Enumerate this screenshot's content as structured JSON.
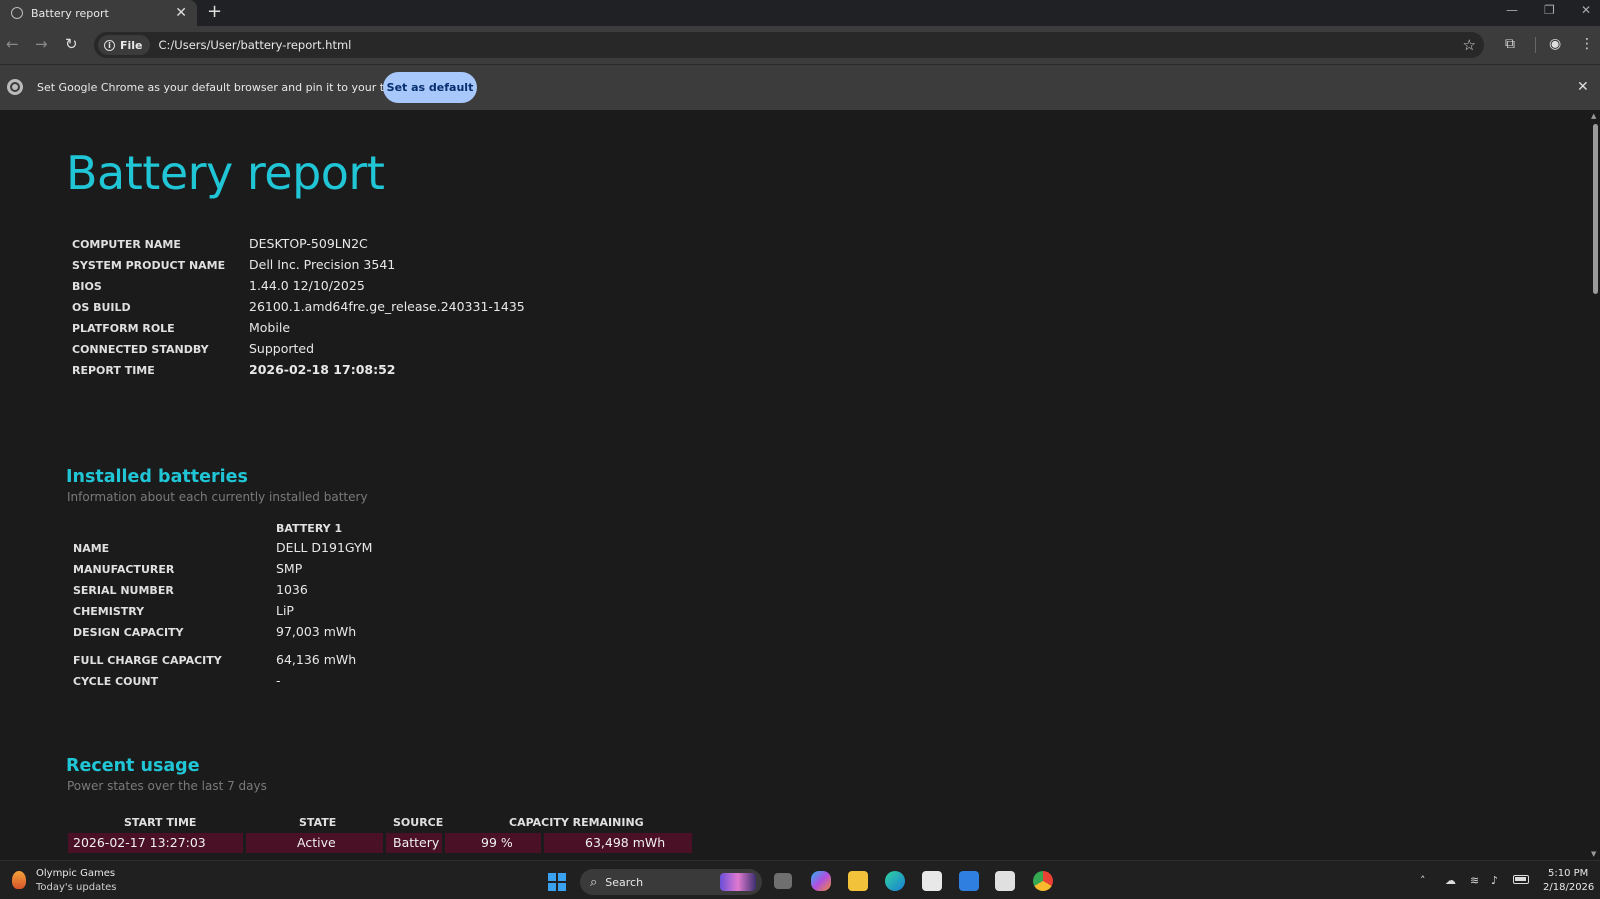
{
  "browser": {
    "tab_title": "Battery report",
    "tab_close": "✕",
    "new_tab": "+",
    "chip_label": "File",
    "url": "C:/Users/User/battery-report.html",
    "infobar_text": "Set Google Chrome as your default browser and pin it to your taskbar",
    "set_default_label": "Set as default",
    "infobar_close": "✕"
  },
  "report": {
    "title": "Battery report",
    "system": [
      {
        "key": "COMPUTER NAME",
        "value": "DESKTOP-509LN2C"
      },
      {
        "key": "SYSTEM PRODUCT NAME",
        "value": "Dell Inc. Precision 3541"
      },
      {
        "key": "BIOS",
        "value": "1.44.0 12/10/2025"
      },
      {
        "key": "OS BUILD",
        "value": "26100.1.amd64fre.ge_release.240331-1435"
      },
      {
        "key": "PLATFORM ROLE",
        "value": "Mobile"
      },
      {
        "key": "CONNECTED STANDBY",
        "value": "Supported"
      },
      {
        "key": "REPORT TIME",
        "value": "2026-02-18   17:08:52"
      }
    ],
    "installed_batteries": {
      "title": "Installed batteries",
      "subtitle": "Information about each currently installed battery",
      "column_header": "BATTERY 1",
      "rows": [
        {
          "key": "NAME",
          "value": "DELL D191GYM"
        },
        {
          "key": "MANUFACTURER",
          "value": "SMP"
        },
        {
          "key": "SERIAL NUMBER",
          "value": "1036"
        },
        {
          "key": "CHEMISTRY",
          "value": "LiP"
        },
        {
          "key": "DESIGN CAPACITY",
          "value": "97,003 mWh"
        },
        {
          "key": "FULL CHARGE CAPACITY",
          "value": "64,136 mWh"
        },
        {
          "key": "CYCLE COUNT",
          "value": "-"
        }
      ]
    },
    "recent_usage": {
      "title": "Recent usage",
      "subtitle": "Power states over the last 7 days",
      "headers": [
        "START TIME",
        "STATE",
        "SOURCE",
        "CAPACITY REMAINING"
      ],
      "row": {
        "start_time": "2026-02-17   13:27:03",
        "state": "Active",
        "source": "Battery",
        "percent": "99 %",
        "capacity": "63,498 mWh"
      },
      "row_color": "#4a1026"
    }
  },
  "taskbar": {
    "news_title": "Olympic Games",
    "news_sub": "Today's updates",
    "search_label": "Search",
    "time": "5:10 PM",
    "date": "2/18/2026"
  },
  "colors": {
    "accent": "#21c6d6",
    "background": "#1b1b1b",
    "chrome_frame": "#3c3c3c"
  }
}
